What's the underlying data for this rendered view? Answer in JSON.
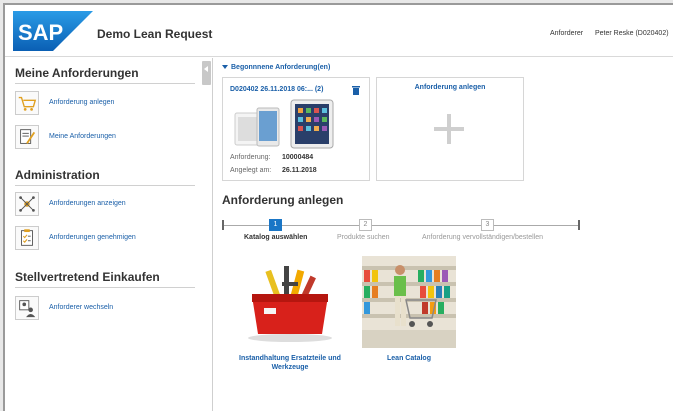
{
  "header": {
    "app_title": "Demo Lean Request",
    "role_label": "Anforderer",
    "user_name": "Peter Reske (D020402)",
    "logo_text": "SAP"
  },
  "sidebar": {
    "sections": [
      {
        "title": "Meine Anforderungen",
        "items": [
          {
            "label": "Anforderung anlegen",
            "icon": "cart-icon"
          },
          {
            "label": "Meine Anforderungen",
            "icon": "edit-document-icon"
          }
        ]
      },
      {
        "title": "Administration",
        "items": [
          {
            "label": "Anforderungen anzeigen",
            "icon": "network-icon"
          },
          {
            "label": "Anforderungen genehmigen",
            "icon": "checklist-icon"
          }
        ]
      },
      {
        "title": "Stellvertretend Einkaufen",
        "items": [
          {
            "label": "Anforderer wechseln",
            "icon": "switch-user-icon"
          }
        ]
      }
    ]
  },
  "main": {
    "group_header": "Begonnnene Anforderung(en)",
    "draft_tile": {
      "title": "D020402 26.11.2018 06:... (2)",
      "req_label": "Anforderung:",
      "req_value": "10000484",
      "created_label": "Angelegt am:",
      "created_value": "26.11.2018"
    },
    "new_tile": {
      "title": "Anforderung anlegen"
    },
    "section_title": "Anforderung anlegen",
    "steps": [
      {
        "number": "1",
        "label": "Katalog auswählen",
        "active": true
      },
      {
        "number": "2",
        "label": "Produkte suchen",
        "active": false
      },
      {
        "number": "3",
        "label": "Anforderung vervollständigen/bestellen",
        "active": false
      }
    ],
    "catalogs": [
      {
        "label": "Instandhaltung Ersatzteile und Werkzeuge"
      },
      {
        "label": "Lean Catalog"
      }
    ]
  },
  "colors": {
    "brand_blue": "#1a76c6",
    "link_blue": "#1a5fa8"
  }
}
